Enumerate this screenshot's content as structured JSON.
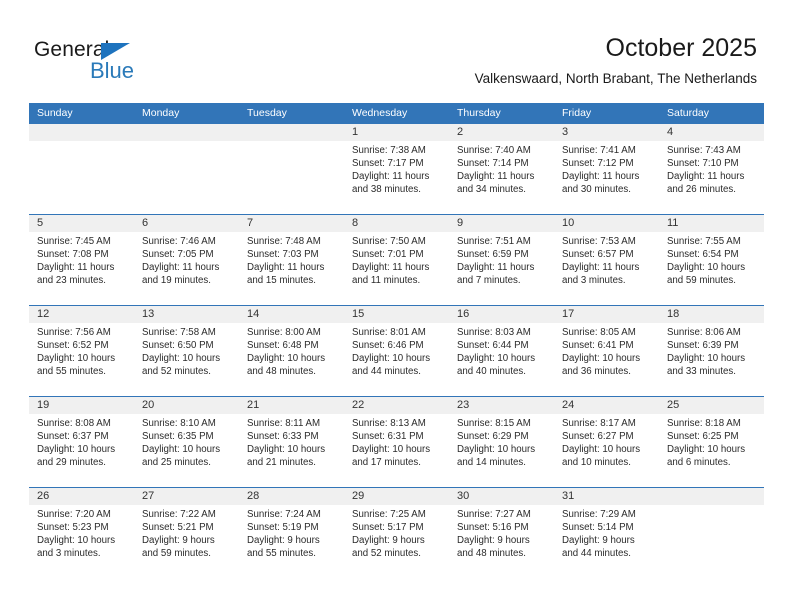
{
  "brand": {
    "name_part1": "General",
    "name_part2": "Blue",
    "accent_color": "#2a7ab9",
    "triangle_color": "#1e73be"
  },
  "header": {
    "title": "October 2025",
    "subtitle": "Valkenswaard, North Brabant, The Netherlands"
  },
  "calendar": {
    "header_bg": "#3275b8",
    "day_band_bg": "#f0f0f0",
    "weekdays": [
      "Sunday",
      "Monday",
      "Tuesday",
      "Wednesday",
      "Thursday",
      "Friday",
      "Saturday"
    ],
    "weeks": [
      [
        {
          "day": "",
          "empty": true
        },
        {
          "day": "",
          "empty": true
        },
        {
          "day": "",
          "empty": true
        },
        {
          "day": "1",
          "sunrise": "Sunrise: 7:38 AM",
          "sunset": "Sunset: 7:17 PM",
          "daylight_line1": "Daylight: 11 hours",
          "daylight_line2": "and 38 minutes."
        },
        {
          "day": "2",
          "sunrise": "Sunrise: 7:40 AM",
          "sunset": "Sunset: 7:14 PM",
          "daylight_line1": "Daylight: 11 hours",
          "daylight_line2": "and 34 minutes."
        },
        {
          "day": "3",
          "sunrise": "Sunrise: 7:41 AM",
          "sunset": "Sunset: 7:12 PM",
          "daylight_line1": "Daylight: 11 hours",
          "daylight_line2": "and 30 minutes."
        },
        {
          "day": "4",
          "sunrise": "Sunrise: 7:43 AM",
          "sunset": "Sunset: 7:10 PM",
          "daylight_line1": "Daylight: 11 hours",
          "daylight_line2": "and 26 minutes."
        }
      ],
      [
        {
          "day": "5",
          "sunrise": "Sunrise: 7:45 AM",
          "sunset": "Sunset: 7:08 PM",
          "daylight_line1": "Daylight: 11 hours",
          "daylight_line2": "and 23 minutes."
        },
        {
          "day": "6",
          "sunrise": "Sunrise: 7:46 AM",
          "sunset": "Sunset: 7:05 PM",
          "daylight_line1": "Daylight: 11 hours",
          "daylight_line2": "and 19 minutes."
        },
        {
          "day": "7",
          "sunrise": "Sunrise: 7:48 AM",
          "sunset": "Sunset: 7:03 PM",
          "daylight_line1": "Daylight: 11 hours",
          "daylight_line2": "and 15 minutes."
        },
        {
          "day": "8",
          "sunrise": "Sunrise: 7:50 AM",
          "sunset": "Sunset: 7:01 PM",
          "daylight_line1": "Daylight: 11 hours",
          "daylight_line2": "and 11 minutes."
        },
        {
          "day": "9",
          "sunrise": "Sunrise: 7:51 AM",
          "sunset": "Sunset: 6:59 PM",
          "daylight_line1": "Daylight: 11 hours",
          "daylight_line2": "and 7 minutes."
        },
        {
          "day": "10",
          "sunrise": "Sunrise: 7:53 AM",
          "sunset": "Sunset: 6:57 PM",
          "daylight_line1": "Daylight: 11 hours",
          "daylight_line2": "and 3 minutes."
        },
        {
          "day": "11",
          "sunrise": "Sunrise: 7:55 AM",
          "sunset": "Sunset: 6:54 PM",
          "daylight_line1": "Daylight: 10 hours",
          "daylight_line2": "and 59 minutes."
        }
      ],
      [
        {
          "day": "12",
          "sunrise": "Sunrise: 7:56 AM",
          "sunset": "Sunset: 6:52 PM",
          "daylight_line1": "Daylight: 10 hours",
          "daylight_line2": "and 55 minutes."
        },
        {
          "day": "13",
          "sunrise": "Sunrise: 7:58 AM",
          "sunset": "Sunset: 6:50 PM",
          "daylight_line1": "Daylight: 10 hours",
          "daylight_line2": "and 52 minutes."
        },
        {
          "day": "14",
          "sunrise": "Sunrise: 8:00 AM",
          "sunset": "Sunset: 6:48 PM",
          "daylight_line1": "Daylight: 10 hours",
          "daylight_line2": "and 48 minutes."
        },
        {
          "day": "15",
          "sunrise": "Sunrise: 8:01 AM",
          "sunset": "Sunset: 6:46 PM",
          "daylight_line1": "Daylight: 10 hours",
          "daylight_line2": "and 44 minutes."
        },
        {
          "day": "16",
          "sunrise": "Sunrise: 8:03 AM",
          "sunset": "Sunset: 6:44 PM",
          "daylight_line1": "Daylight: 10 hours",
          "daylight_line2": "and 40 minutes."
        },
        {
          "day": "17",
          "sunrise": "Sunrise: 8:05 AM",
          "sunset": "Sunset: 6:41 PM",
          "daylight_line1": "Daylight: 10 hours",
          "daylight_line2": "and 36 minutes."
        },
        {
          "day": "18",
          "sunrise": "Sunrise: 8:06 AM",
          "sunset": "Sunset: 6:39 PM",
          "daylight_line1": "Daylight: 10 hours",
          "daylight_line2": "and 33 minutes."
        }
      ],
      [
        {
          "day": "19",
          "sunrise": "Sunrise: 8:08 AM",
          "sunset": "Sunset: 6:37 PM",
          "daylight_line1": "Daylight: 10 hours",
          "daylight_line2": "and 29 minutes."
        },
        {
          "day": "20",
          "sunrise": "Sunrise: 8:10 AM",
          "sunset": "Sunset: 6:35 PM",
          "daylight_line1": "Daylight: 10 hours",
          "daylight_line2": "and 25 minutes."
        },
        {
          "day": "21",
          "sunrise": "Sunrise: 8:11 AM",
          "sunset": "Sunset: 6:33 PM",
          "daylight_line1": "Daylight: 10 hours",
          "daylight_line2": "and 21 minutes."
        },
        {
          "day": "22",
          "sunrise": "Sunrise: 8:13 AM",
          "sunset": "Sunset: 6:31 PM",
          "daylight_line1": "Daylight: 10 hours",
          "daylight_line2": "and 17 minutes."
        },
        {
          "day": "23",
          "sunrise": "Sunrise: 8:15 AM",
          "sunset": "Sunset: 6:29 PM",
          "daylight_line1": "Daylight: 10 hours",
          "daylight_line2": "and 14 minutes."
        },
        {
          "day": "24",
          "sunrise": "Sunrise: 8:17 AM",
          "sunset": "Sunset: 6:27 PM",
          "daylight_line1": "Daylight: 10 hours",
          "daylight_line2": "and 10 minutes."
        },
        {
          "day": "25",
          "sunrise": "Sunrise: 8:18 AM",
          "sunset": "Sunset: 6:25 PM",
          "daylight_line1": "Daylight: 10 hours",
          "daylight_line2": "and 6 minutes."
        }
      ],
      [
        {
          "day": "26",
          "sunrise": "Sunrise: 7:20 AM",
          "sunset": "Sunset: 5:23 PM",
          "daylight_line1": "Daylight: 10 hours",
          "daylight_line2": "and 3 minutes."
        },
        {
          "day": "27",
          "sunrise": "Sunrise: 7:22 AM",
          "sunset": "Sunset: 5:21 PM",
          "daylight_line1": "Daylight: 9 hours",
          "daylight_line2": "and 59 minutes."
        },
        {
          "day": "28",
          "sunrise": "Sunrise: 7:24 AM",
          "sunset": "Sunset: 5:19 PM",
          "daylight_line1": "Daylight: 9 hours",
          "daylight_line2": "and 55 minutes."
        },
        {
          "day": "29",
          "sunrise": "Sunrise: 7:25 AM",
          "sunset": "Sunset: 5:17 PM",
          "daylight_line1": "Daylight: 9 hours",
          "daylight_line2": "and 52 minutes."
        },
        {
          "day": "30",
          "sunrise": "Sunrise: 7:27 AM",
          "sunset": "Sunset: 5:16 PM",
          "daylight_line1": "Daylight: 9 hours",
          "daylight_line2": "and 48 minutes."
        },
        {
          "day": "31",
          "sunrise": "Sunrise: 7:29 AM",
          "sunset": "Sunset: 5:14 PM",
          "daylight_line1": "Daylight: 9 hours",
          "daylight_line2": "and 44 minutes."
        },
        {
          "day": "",
          "empty": true
        }
      ]
    ]
  }
}
